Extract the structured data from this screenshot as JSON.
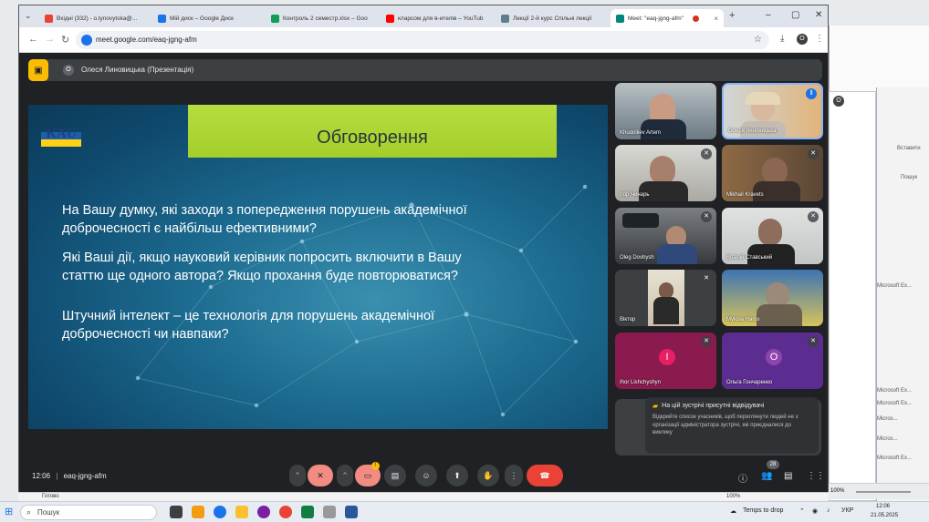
{
  "browser": {
    "tabs": [
      {
        "label": "Вхідні (332) - o.lynovytska@...",
        "color": "#ea4335"
      },
      {
        "label": "Мій диск – Google Диск",
        "color": "#1a73e8"
      },
      {
        "label": "Контроль 2 семестр.xlsx – Goo",
        "color": "#0f9d58"
      },
      {
        "label": "кларсом для в-ителів – YouTub",
        "color": "#ff0000"
      },
      {
        "label": "Лекції 2-й курс Спільні лекції",
        "color": "#607d8b"
      },
      {
        "label": "Meet: \"eaq-jgng-afm\"",
        "color": "#00897b"
      }
    ],
    "url": "meet.google.com/eaq-jgng-afm",
    "profile_initial": "O"
  },
  "presenter_bar": {
    "avatar": "O",
    "text": "Олеся Линовицька (Презентація)"
  },
  "slide": {
    "logo": "KAU",
    "title": "Обговорення",
    "questions": [
      {
        "l1": "На Вашу думку, які  заходи з попередження порушень академічної",
        "l2": "доброчесності  є найбільш ефективними?"
      },
      {
        "l1": "Які Ваші дії, якщо науковий керівник попросить  включити в Вашу",
        "l2": "статтю ще одного автора? Якщо прохання буде повторюватися?"
      },
      {
        "l1": "Штучний інтелект – це технологія  для порушень  академічної",
        "l2": "доброчесності чи навпаки?"
      }
    ]
  },
  "participants": [
    {
      "name": "Khudoliiev Artem",
      "muted": false,
      "avatar": ""
    },
    {
      "name": "Олеся Линовицька",
      "muted": false,
      "speaking": true,
      "avatar": ""
    },
    {
      "name": "Ігор Чинарь",
      "muted": true,
      "avatar": ""
    },
    {
      "name": "Mikhail Kravets",
      "muted": true,
      "avatar": ""
    },
    {
      "name": "Oleg Dovbysh",
      "muted": true,
      "avatar": ""
    },
    {
      "name": "Віталій Ставський",
      "muted": true,
      "avatar": ""
    },
    {
      "name": "Віктор",
      "muted": true,
      "avatar": ""
    },
    {
      "name": "Mykola Harus",
      "muted": false,
      "avatar": ""
    },
    {
      "name": "Ihor Lishchyshyn",
      "muted": true,
      "avatar": "I",
      "color": "#c2185b"
    },
    {
      "name": "Ольга Гончаренко",
      "muted": true,
      "avatar": "O",
      "color": "#7b1fa2"
    }
  ],
  "notification": {
    "title": "На цій зустрічі присутні відвідувачі",
    "body": "Відкрийте список учасників, щоб переглянути людей не з організації адміністратора зустрічі, які приєдналися до виклику"
  },
  "controls": {
    "time": "12:06",
    "separator": "|",
    "meeting_code": "eaq-jgng-afm",
    "participant_count": "28",
    "warning": "!"
  },
  "taskbar": {
    "search_placeholder": "Пошук",
    "weather": "Temps to drop",
    "lang": "УКР",
    "time": "12:06",
    "date": "21.05.2025"
  },
  "background_window": {
    "status_left": "Готово",
    "zoom": "100%",
    "zoom2": "100%",
    "side_items": [
      "Вставити",
      "Пошук",
      "Microsoft Ex...",
      "Microsoft Ex...",
      "Microsoft Ex...",
      "Micros...",
      "Micros...",
      "Microsoft Ex..."
    ]
  }
}
